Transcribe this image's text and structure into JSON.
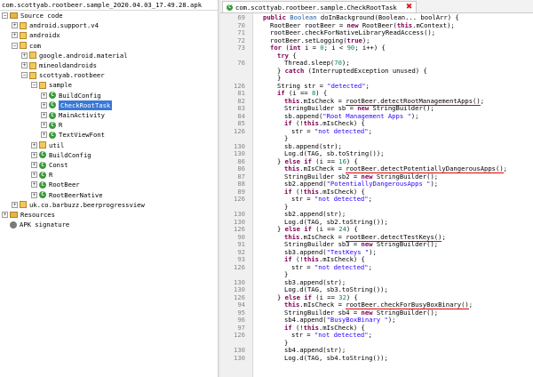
{
  "tree": {
    "title": "com.scottyab.rootbeer.sample_2020.04.03_17.49.28.apk",
    "items": [
      {
        "depth": 0,
        "toggle": "−",
        "icon": "folder",
        "label": "Source code"
      },
      {
        "depth": 1,
        "toggle": "+",
        "icon": "package",
        "label": "android.support.v4"
      },
      {
        "depth": 1,
        "toggle": "+",
        "icon": "package",
        "label": "androidx"
      },
      {
        "depth": 1,
        "toggle": "−",
        "icon": "package",
        "label": "com"
      },
      {
        "depth": 2,
        "toggle": "+",
        "icon": "package",
        "label": "google.android.material"
      },
      {
        "depth": 2,
        "toggle": "+",
        "icon": "package",
        "label": "mineoldandroids"
      },
      {
        "depth": 2,
        "toggle": "−",
        "icon": "package",
        "label": "scottyab.rootbeer"
      },
      {
        "depth": 3,
        "toggle": "−",
        "icon": "package",
        "label": "sample"
      },
      {
        "depth": 4,
        "toggle": "+",
        "icon": "class",
        "label": "BuildConfig"
      },
      {
        "depth": 4,
        "toggle": "+",
        "icon": "class",
        "label": "CheckRootTask",
        "selected": true
      },
      {
        "depth": 4,
        "toggle": "+",
        "icon": "class",
        "label": "MainActivity"
      },
      {
        "depth": 4,
        "toggle": "+",
        "icon": "class",
        "label": "R"
      },
      {
        "depth": 4,
        "toggle": "+",
        "icon": "class",
        "label": "TextViewFont"
      },
      {
        "depth": 3,
        "toggle": "+",
        "icon": "package",
        "label": "util"
      },
      {
        "depth": 3,
        "toggle": "+",
        "icon": "class",
        "label": "BuildConfig"
      },
      {
        "depth": 3,
        "toggle": "+",
        "icon": "class",
        "label": "Const"
      },
      {
        "depth": 3,
        "toggle": "+",
        "icon": "class",
        "label": "R"
      },
      {
        "depth": 3,
        "toggle": "+",
        "icon": "class",
        "label": "RootBeer"
      },
      {
        "depth": 3,
        "toggle": "+",
        "icon": "class",
        "label": "RootBeerNative"
      },
      {
        "depth": 1,
        "toggle": "+",
        "icon": "package",
        "label": "uk.co.barbuzz.beerprogressview"
      },
      {
        "depth": 0,
        "toggle": "+",
        "icon": "folder",
        "label": "Resources"
      },
      {
        "depth": 0,
        "toggle": "",
        "icon": "gear",
        "label": "APK signature"
      }
    ]
  },
  "editor": {
    "tab_title": "com.scottyab.rootbeer.sample.CheckRootTask",
    "close_glyph": "✖",
    "lines": [
      {
        "n": "69",
        "indent": 1,
        "parts": [
          [
            "kw",
            "public "
          ],
          [
            "cls",
            "Boolean "
          ],
          [
            "",
            "doInBackground(Boolean... boolArr) {"
          ]
        ]
      },
      {
        "n": "70",
        "indent": 2,
        "parts": [
          [
            "",
            "RootBeer rootBeer = "
          ],
          [
            "kw",
            "new "
          ],
          [
            "",
            "RootBeer("
          ],
          [
            "kw",
            "this"
          ],
          [
            "",
            ".mContext);"
          ]
        ]
      },
      {
        "n": "71",
        "indent": 2,
        "parts": [
          [
            "",
            "rootBeer.checkForNativeLibraryReadAccess();"
          ]
        ]
      },
      {
        "n": "72",
        "indent": 2,
        "parts": [
          [
            "",
            "rootBeer.setLogging("
          ],
          [
            "kw",
            "true"
          ],
          [
            "",
            ");"
          ]
        ]
      },
      {
        "n": "73",
        "indent": 2,
        "parts": [
          [
            "kw",
            "for "
          ],
          [
            "",
            "("
          ],
          [
            "kw",
            "int "
          ],
          [
            "",
            "i = "
          ],
          [
            "num",
            "0"
          ],
          [
            "",
            "; i < "
          ],
          [
            "num",
            "90"
          ],
          [
            "",
            "; i++) {"
          ]
        ]
      },
      {
        "n": "",
        "indent": 3,
        "parts": [
          [
            "kw",
            "try "
          ],
          [
            "",
            "{"
          ]
        ]
      },
      {
        "n": "76",
        "indent": 4,
        "parts": [
          [
            "",
            "Thread.sleep("
          ],
          [
            "num",
            "70"
          ],
          [
            "",
            ");"
          ]
        ]
      },
      {
        "n": "",
        "indent": 3,
        "parts": [
          [
            "",
            "} "
          ],
          [
            "kw",
            "catch "
          ],
          [
            "",
            "(InterruptedException unused) {"
          ]
        ]
      },
      {
        "n": "",
        "indent": 3,
        "parts": [
          [
            "",
            "}"
          ]
        ]
      },
      {
        "n": "126",
        "indent": 3,
        "parts": [
          [
            "",
            "String str = "
          ],
          [
            "str",
            "\"detected\""
          ],
          [
            "",
            ";"
          ]
        ]
      },
      {
        "n": "81",
        "indent": 3,
        "parts": [
          [
            "kw",
            "if "
          ],
          [
            "",
            "(i == "
          ],
          [
            "num",
            "8"
          ],
          [
            "",
            ") {"
          ]
        ]
      },
      {
        "n": "82",
        "indent": 4,
        "parts": [
          [
            "kw",
            "this"
          ],
          [
            "",
            ".mIsCheck = "
          ],
          [
            "hl",
            "rootBeer.detectRootManagementApps()"
          ],
          [
            "",
            ";"
          ]
        ]
      },
      {
        "n": "83",
        "indent": 4,
        "parts": [
          [
            "",
            "StringBuilder sb = "
          ],
          [
            "kw",
            "new "
          ],
          [
            "",
            "StringBuilder();"
          ]
        ]
      },
      {
        "n": "84",
        "indent": 4,
        "parts": [
          [
            "",
            "sb.append("
          ],
          [
            "str",
            "\"Root Management Apps \""
          ],
          [
            "",
            ");"
          ]
        ]
      },
      {
        "n": "85",
        "indent": 4,
        "parts": [
          [
            "kw",
            "if "
          ],
          [
            "",
            "(!"
          ],
          [
            "kw",
            "this"
          ],
          [
            "",
            ".mIsCheck) {"
          ]
        ]
      },
      {
        "n": "126",
        "indent": 5,
        "parts": [
          [
            "",
            "str = "
          ],
          [
            "str",
            "\"not detected\""
          ],
          [
            "",
            ";"
          ]
        ]
      },
      {
        "n": "",
        "indent": 4,
        "parts": [
          [
            "",
            "}"
          ]
        ]
      },
      {
        "n": "130",
        "indent": 4,
        "parts": [
          [
            "",
            "sb.append(str);"
          ]
        ]
      },
      {
        "n": "130",
        "indent": 4,
        "parts": [
          [
            "",
            "Log.d(TAG, sb.toString());"
          ]
        ]
      },
      {
        "n": "86",
        "indent": 3,
        "parts": [
          [
            "",
            "} "
          ],
          [
            "kw",
            "else if "
          ],
          [
            "",
            "(i == "
          ],
          [
            "num",
            "16"
          ],
          [
            "",
            ") {"
          ]
        ]
      },
      {
        "n": "86",
        "indent": 4,
        "parts": [
          [
            "kw",
            "this"
          ],
          [
            "",
            ".mIsCheck = "
          ],
          [
            "hl",
            "rootBeer.detectPotentiallyDangerousApps()"
          ],
          [
            "",
            ";"
          ]
        ]
      },
      {
        "n": "87",
        "indent": 4,
        "parts": [
          [
            "",
            "StringBuilder sb2 = "
          ],
          [
            "kw",
            "new "
          ],
          [
            "",
            "StringBuilder();"
          ]
        ]
      },
      {
        "n": "88",
        "indent": 4,
        "parts": [
          [
            "",
            "sb2.append("
          ],
          [
            "str",
            "\"PotentiallyDangerousApps \""
          ],
          [
            "",
            ");"
          ]
        ]
      },
      {
        "n": "89",
        "indent": 4,
        "parts": [
          [
            "kw",
            "if "
          ],
          [
            "",
            "(!"
          ],
          [
            "kw",
            "this"
          ],
          [
            "",
            ".mIsCheck) {"
          ]
        ]
      },
      {
        "n": "126",
        "indent": 5,
        "parts": [
          [
            "",
            "str = "
          ],
          [
            "str",
            "\"not detected\""
          ],
          [
            "",
            ";"
          ]
        ]
      },
      {
        "n": "",
        "indent": 4,
        "parts": [
          [
            "",
            "}"
          ]
        ]
      },
      {
        "n": "130",
        "indent": 4,
        "parts": [
          [
            "",
            "sb2.append(str);"
          ]
        ]
      },
      {
        "n": "130",
        "indent": 4,
        "parts": [
          [
            "",
            "Log.d(TAG, sb2.toString());"
          ]
        ]
      },
      {
        "n": "126",
        "indent": 3,
        "parts": [
          [
            "",
            "} "
          ],
          [
            "kw",
            "else if "
          ],
          [
            "",
            "(i == "
          ],
          [
            "num",
            "24"
          ],
          [
            "",
            ") {"
          ]
        ]
      },
      {
        "n": "90",
        "indent": 4,
        "parts": [
          [
            "kw",
            "this"
          ],
          [
            "",
            ".mIsCheck = "
          ],
          [
            "hl",
            "rootBeer.detectTestKeys()"
          ],
          [
            "",
            ";"
          ]
        ]
      },
      {
        "n": "91",
        "indent": 4,
        "parts": [
          [
            "",
            "StringBuilder sb3 = "
          ],
          [
            "kw",
            "new "
          ],
          [
            "",
            "StringBuilder();"
          ]
        ]
      },
      {
        "n": "92",
        "indent": 4,
        "parts": [
          [
            "",
            "sb3.append("
          ],
          [
            "str",
            "\"TestKeys \""
          ],
          [
            "",
            ");"
          ]
        ]
      },
      {
        "n": "93",
        "indent": 4,
        "parts": [
          [
            "kw",
            "if "
          ],
          [
            "",
            "(!"
          ],
          [
            "kw",
            "this"
          ],
          [
            "",
            ".mIsCheck) {"
          ]
        ]
      },
      {
        "n": "126",
        "indent": 5,
        "parts": [
          [
            "",
            "str = "
          ],
          [
            "str",
            "\"not detected\""
          ],
          [
            "",
            ";"
          ]
        ]
      },
      {
        "n": "",
        "indent": 4,
        "parts": [
          [
            "",
            "}"
          ]
        ]
      },
      {
        "n": "130",
        "indent": 4,
        "parts": [
          [
            "",
            "sb3.append(str);"
          ]
        ]
      },
      {
        "n": "130",
        "indent": 4,
        "parts": [
          [
            "",
            "Log.d(TAG, sb3.toString());"
          ]
        ]
      },
      {
        "n": "126",
        "indent": 3,
        "parts": [
          [
            "",
            "} "
          ],
          [
            "kw",
            "else if "
          ],
          [
            "",
            "(i == "
          ],
          [
            "num",
            "32"
          ],
          [
            "",
            ") {"
          ]
        ]
      },
      {
        "n": "94",
        "indent": 4,
        "parts": [
          [
            "kw",
            "this"
          ],
          [
            "",
            ".mIsCheck = "
          ],
          [
            "hl",
            "rootBeer.checkForBusyBoxBinary()"
          ],
          [
            "",
            ";"
          ]
        ]
      },
      {
        "n": "95",
        "indent": 4,
        "parts": [
          [
            "",
            "StringBuilder sb4 = "
          ],
          [
            "kw",
            "new "
          ],
          [
            "",
            "StringBuilder();"
          ]
        ]
      },
      {
        "n": "96",
        "indent": 4,
        "parts": [
          [
            "",
            "sb4.append("
          ],
          [
            "str",
            "\"BusyBoxBinary \""
          ],
          [
            "",
            ");"
          ]
        ]
      },
      {
        "n": "97",
        "indent": 4,
        "parts": [
          [
            "kw",
            "if "
          ],
          [
            "",
            "(!"
          ],
          [
            "kw",
            "this"
          ],
          [
            "",
            ".mIsCheck) {"
          ]
        ]
      },
      {
        "n": "126",
        "indent": 5,
        "parts": [
          [
            "",
            "str = "
          ],
          [
            "str",
            "\"not detected\""
          ],
          [
            "",
            ";"
          ]
        ]
      },
      {
        "n": "",
        "indent": 4,
        "parts": [
          [
            "",
            "}"
          ]
        ]
      },
      {
        "n": "130",
        "indent": 4,
        "parts": [
          [
            "",
            "sb4.append(str);"
          ]
        ]
      },
      {
        "n": "130",
        "indent": 4,
        "parts": [
          [
            "",
            "Log.d(TAG, sb4.toString());"
          ]
        ]
      }
    ]
  }
}
